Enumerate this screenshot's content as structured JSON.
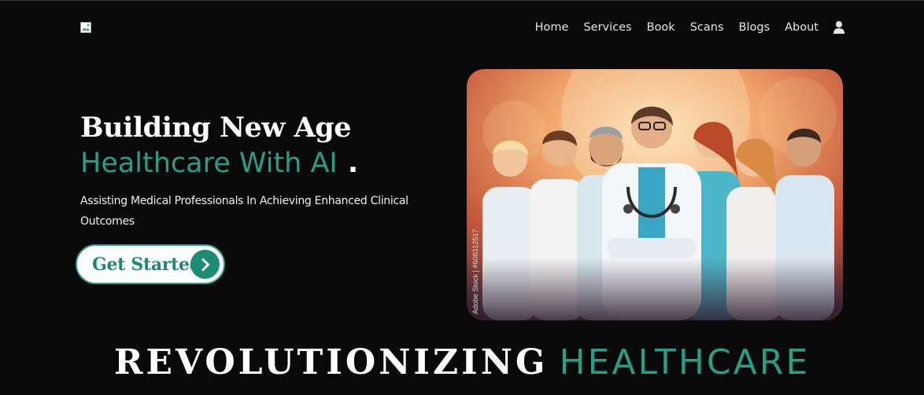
{
  "nav": {
    "items": [
      "Home",
      "Services",
      "Book",
      "Scans",
      "Blogs",
      "About"
    ]
  },
  "hero": {
    "title_line1": "Building New Age",
    "title_line2": "Healthcare With AI",
    "title_dot": ".",
    "subtitle": "Assisting Medical Professionals In Achieving Enhanced Clinical Outcomes",
    "cta_label": "Get Started",
    "image_watermark": "Adobe Stock | #608312517"
  },
  "section": {
    "title_part1": "REVOLUTIONIZING",
    "title_part2": "HEALTHCARE"
  },
  "colors": {
    "background": "#0a0909",
    "accent": "#2a9d86",
    "text": "#ffffff"
  },
  "icons": {
    "logo": "broken-image-icon",
    "user": "user-icon",
    "cta_arrow": "chevron-right-icon"
  }
}
